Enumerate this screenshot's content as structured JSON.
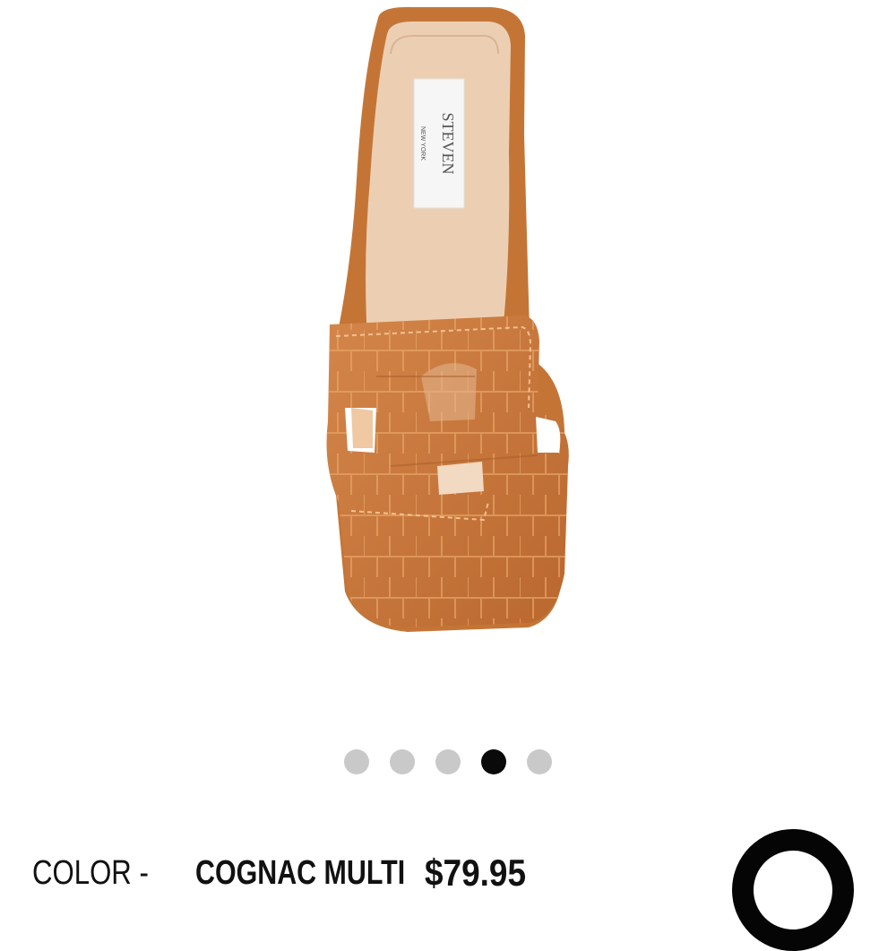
{
  "product": {
    "image_alt": "Cognac croc-embossed slide sandal, top view",
    "brand_tag_line1": "STEVEN",
    "brand_tag_line2": "NEW YORK"
  },
  "carousel": {
    "total": 5,
    "active_index": 3
  },
  "info": {
    "color_label": "COLOR - ",
    "color_value": "COGNAC MULTI",
    "price": "$79.95"
  },
  "chat": {
    "icon": "chat-bubble-icon"
  },
  "colors": {
    "dot_inactive": "#c9c9c9",
    "dot_active": "#0a0a0a",
    "leather": "#c9773a"
  }
}
